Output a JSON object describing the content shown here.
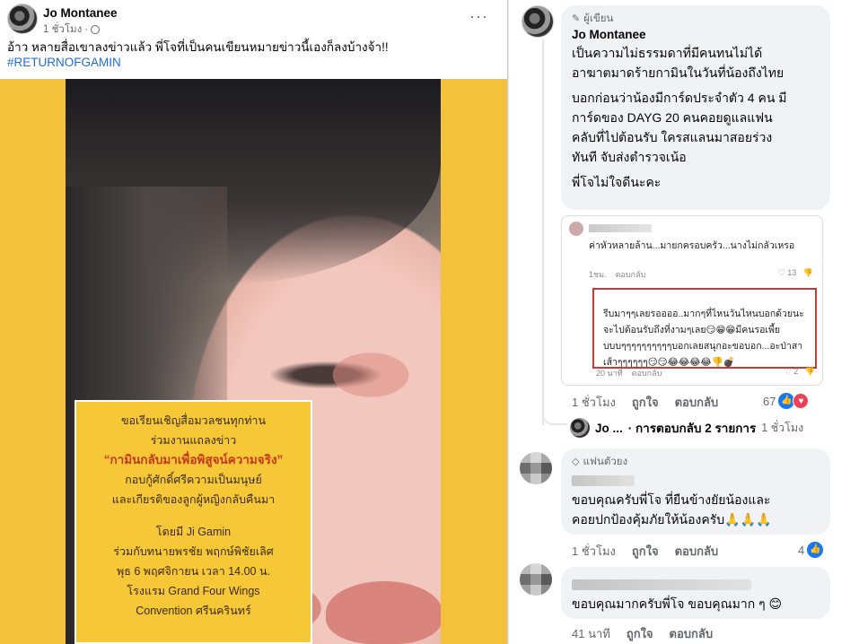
{
  "post": {
    "author": "Jo Montanee",
    "time": "1 ชั่วโมง",
    "more": "···",
    "caption": "อ้าว หลายสื่อเขาลงข่าวแล้ว พี่โจที่เป็นคนเขียนหมายข่าวนี้เองก็ลงบ้างจ้า!!",
    "hashtag": "#RETURNOFGAMIN",
    "invite": {
      "line1": "ขอเรียนเชิญสื่อมวลชนทุกท่าน",
      "line2": "ร่วมงานแถลงข่าว",
      "headline": "“กามินกลับมาเพื่อพิสูจน์ความจริง”",
      "line3": "กอบกู้ศักดิ์ศรีความเป็นมนุษย์",
      "line4": "และเกียรติของลูกผู้หญิงกลับคืนมา",
      "line5": "โดยมี Ji Gamin",
      "line6": "ร่วมกับทนายพรชัย พฤกษ์พิชัยเลิศ",
      "line7": "พุธ 6 พฤศจิกายน เวลา 14.00 น.",
      "line8": "โรงแรม Grand Four Wings",
      "line9": "Convention ศรีนครินทร์"
    }
  },
  "comments": {
    "c1": {
      "badge": "ผู้เขียน",
      "name": "Jo Montanee",
      "p1_l1": "เป็นความไม่ธรรมดาที่มีคนทนไม่ได้",
      "p1_l2": "อาฆาตมาดร้ายกามินในวันที่น้องถึงไทย",
      "p2_l1": "บอกก่อนว่าน้องมีการ์ดประจำตัว 4 คน มี",
      "p2_l2": "การ์ดของ DAYG 20 คนคอยดูแลแฟน",
      "p2_l3": "คลับที่ไปต้อนรับ ใครสแลนมาสอยร่วง",
      "p2_l4": "ทันที จับส่งตำรวจเน้อ",
      "p3": "พี่โจไม่ใจดีนะคะ",
      "screenshot": {
        "text1": "ค่าหัวหลายล้าน...มายกครอบครัว...นางไม่กลัวเหรอ",
        "time1": "1ชม.",
        "reply1": "ตอบกลับ",
        "likes1": "13",
        "red_l1": "รีบมาๆๆเลยรออออ..มากๆที่ไหนวันไหนบอกด้วยนะ",
        "red_l2": "จะไปต้อนรับถึงที่งามๆเลย😏😁😁มีคนรอเพี้ย",
        "red_l3": "บบบๆๆๆๆๆๆๆๆๆๆบอกเลยสนุกอะขอบอก...อะป่าสา",
        "red_l4": "เส้าๆๆๆๆๆๆ😏😏😂😂😂😂👎💣",
        "time2": "20 นาที",
        "reply2": "ตอบกลับ",
        "likes2": "2"
      },
      "time": "1 ชั่วโมง",
      "like": "ถูกใจ",
      "reply": "ตอบกลับ",
      "count": "67"
    },
    "reply_row": {
      "name": "Jo ...",
      "label": "· การตอบกลับ 2 รายการ",
      "time": "1 ชั่วโมง"
    },
    "c2": {
      "badge": "แฟนตัวยง",
      "text_l1": "ขอบคุณครับพี่โจ ที่ยืนข้างยัยน้องและ",
      "text_l2": "คอยปกป้องคุ้มภัยให้น้องครับ🙏🙏🙏",
      "time": "1 ชั่วโมง",
      "like": "ถูกใจ",
      "reply": "ตอบกลับ",
      "count": "4"
    },
    "c3": {
      "text": "ขอบคุณมากครับพี่โจ ขอบคุณมาก ๆ 😊",
      "time": "41 นาที",
      "like": "ถูกใจ",
      "reply": "ตอบกลับ"
    }
  },
  "colors": {
    "link": "#216fdb",
    "facebook_blue": "#1877f2",
    "bubble": "#f0f2f5",
    "poster_yellow": "#f4c23a",
    "highlight_red": "#c8361a"
  },
  "icons": [
    "globe-icon",
    "more-icon",
    "pen-icon",
    "diamond-icon",
    "like-icon",
    "heart-icon"
  ]
}
